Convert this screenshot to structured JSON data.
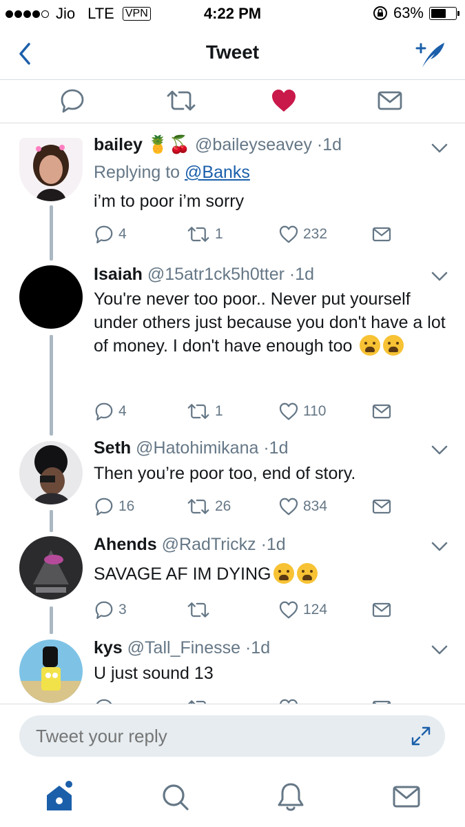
{
  "status_bar": {
    "carrier": "Jio",
    "network": "LTE",
    "vpn": "VPN",
    "time": "4:22 PM",
    "battery_percent": "63%",
    "battery_level": 0.63,
    "signal_bars": 4
  },
  "nav": {
    "title": "Tweet",
    "back_icon": "chevron-left-icon",
    "compose_icon": "compose-tweet-icon"
  },
  "tweet_actions": {
    "liked": true,
    "like_color": "#c9184a"
  },
  "replies": [
    {
      "name": "bailey",
      "name_emoji": "🍍🍒",
      "handle": "@baileyseavey",
      "time": "1d",
      "replying_prefix": "Replying to ",
      "replying_to": "@Banks",
      "text": "i’m to poor i’m sorry",
      "replies": "4",
      "retweets": "1",
      "likes": "232"
    },
    {
      "name": "Isaiah",
      "handle": "@15atr1ck5h0tter",
      "time": "1d",
      "text": "You're never too poor.. Never put yourself under others just because you don't have a lot of money. I don't have enough too",
      "text_emoji": "😭😭",
      "replies": "4",
      "retweets": "1",
      "likes": "110"
    },
    {
      "name": "Seth",
      "handle": "@Hatohimikana",
      "time": "1d",
      "text": "Then you’re poor too, end of story.",
      "replies": "16",
      "retweets": "26",
      "likes": "834"
    },
    {
      "name": "Ahends",
      "handle": "@RadTrickz",
      "time": "1d",
      "text": "SAVAGE AF IM DYING",
      "text_emoji": "😭😂",
      "replies": "3",
      "retweets": "",
      "likes": "124"
    },
    {
      "name": "kys",
      "handle": "@Tall_Finesse",
      "time": "1d",
      "text": "U just sound 13"
    }
  ],
  "reply_box": {
    "placeholder": "Tweet your reply"
  },
  "colors": {
    "accent": "#1b5faa",
    "muted": "#657786",
    "border": "#d8dde2",
    "text": "#14171a"
  }
}
